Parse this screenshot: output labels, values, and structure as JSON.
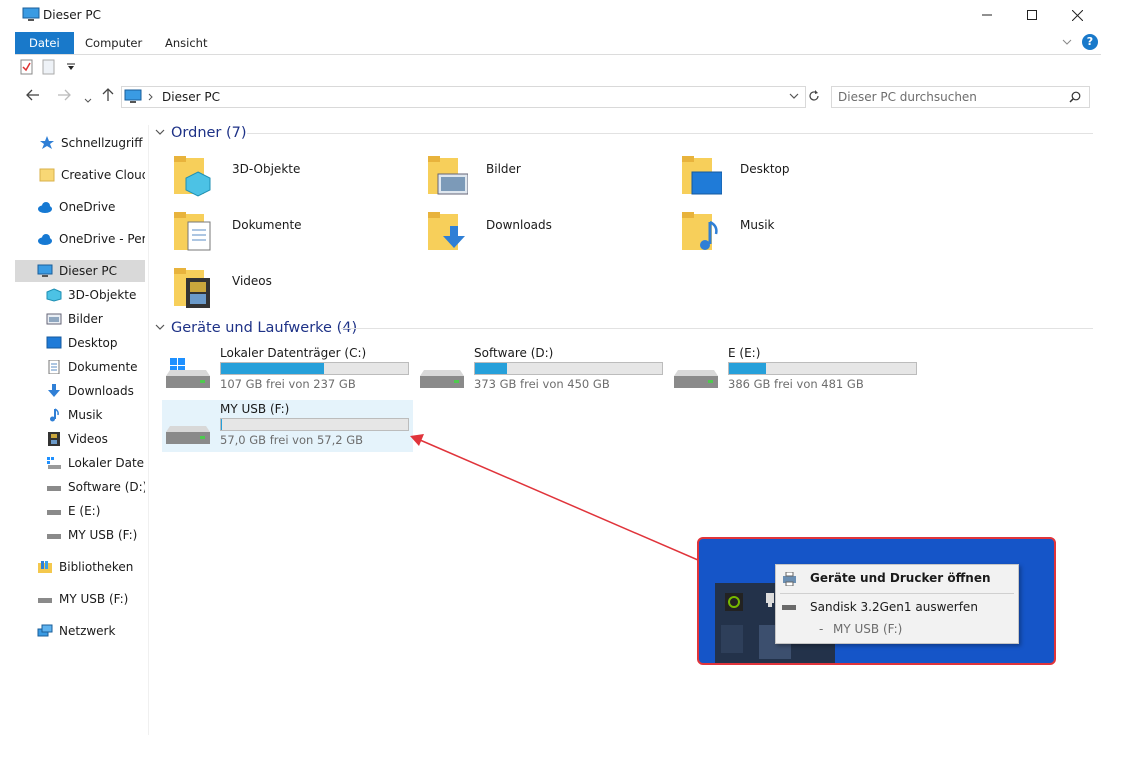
{
  "window": {
    "title": "Dieser PC"
  },
  "ribbon": {
    "tabs": [
      "Datei",
      "Computer",
      "Ansicht"
    ],
    "help": "?"
  },
  "address": {
    "path": "Dieser PC",
    "search_placeholder": "Dieser PC durchsuchen"
  },
  "sidebar": {
    "items": [
      {
        "label": "Schnellzugriff",
        "icon": "star-icon"
      },
      {
        "label": "Creative Cloud F",
        "icon": "folder-icon"
      },
      {
        "label": "OneDrive",
        "icon": "cloud-icon"
      },
      {
        "label": "OneDrive - Perso",
        "icon": "cloud-icon"
      },
      {
        "label": "Dieser PC",
        "icon": "computer-icon"
      },
      {
        "label": "3D-Objekte",
        "icon": "cube-icon"
      },
      {
        "label": "Bilder",
        "icon": "picture-icon"
      },
      {
        "label": "Desktop",
        "icon": "desktop-icon"
      },
      {
        "label": "Dokumente",
        "icon": "document-icon"
      },
      {
        "label": "Downloads",
        "icon": "download-icon"
      },
      {
        "label": "Musik",
        "icon": "music-icon"
      },
      {
        "label": "Videos",
        "icon": "film-icon"
      },
      {
        "label": "Lokaler Datent",
        "icon": "windows-drive-icon"
      },
      {
        "label": "Software (D:)",
        "icon": "drive-icon"
      },
      {
        "label": "E (E:)",
        "icon": "drive-icon"
      },
      {
        "label": "MY USB (F:)",
        "icon": "drive-icon"
      },
      {
        "label": "Bibliotheken",
        "icon": "library-icon"
      },
      {
        "label": "MY USB (F:)",
        "icon": "drive-icon"
      },
      {
        "label": "Netzwerk",
        "icon": "network-icon"
      }
    ]
  },
  "main": {
    "folders_header": "Ordner (7)",
    "folders": [
      "3D-Objekte",
      "Bilder",
      "Desktop",
      "Dokumente",
      "Downloads",
      "Musik",
      "Videos"
    ],
    "drives_header": "Geräte und Laufwerke (4)",
    "drives": [
      {
        "name": "Lokaler Datenträger (C:)",
        "free": "107 GB frei von 237 GB",
        "used_fraction": 0.55
      },
      {
        "name": "Software (D:)",
        "free": "373 GB frei von 450 GB",
        "used_fraction": 0.17
      },
      {
        "name": "E (E:)",
        "free": "386 GB frei von 481 GB",
        "used_fraction": 0.2
      },
      {
        "name": "MY USB (F:)",
        "free": "57,0 GB frei von 57,2 GB",
        "used_fraction": 0.004
      }
    ]
  },
  "popup": {
    "item1": "Geräte und Drucker öffnen",
    "item2": "Sandisk 3.2Gen1 auswerfen",
    "item3_dash": "-",
    "item3": "MY USB (F:)"
  },
  "colors": {
    "accent": "#1979ca",
    "bar_fill": "#26a0da",
    "annotation": "#e0343b"
  }
}
